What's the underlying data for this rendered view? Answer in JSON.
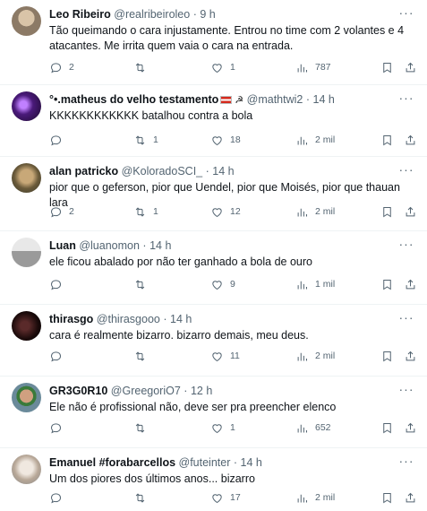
{
  "tweets": [
    {
      "name": "Leo Ribeiro",
      "handle": "@realribeiroleo",
      "time": "9 h",
      "text": "Tão queimando o cara injustamente. Entrou no time com 2 volantes e 4 atacantes. Me irrita quem vaia o cara na entrada.",
      "replies": "2",
      "retweets": "",
      "likes": "1",
      "views": "787",
      "avatar_color": "#b8a58c"
    },
    {
      "name": "°•.matheus do velho testamento",
      "handle": "@mathtwi2",
      "time": "14 h",
      "text": "KKKKKKKKKKKK batalhou contra a bola",
      "replies": "",
      "retweets": "1",
      "likes": "18",
      "views": "2 mil",
      "avatar_color": "#5a2a8a"
    },
    {
      "name": "alan patricko",
      "handle": "@KoloradoSCI_",
      "time": "14 h",
      "text": "pior que o geferson, pior que Uendel, pior que Moisés, pior que thauan lara",
      "replies": "2",
      "retweets": "1",
      "likes": "12",
      "views": "2 mil",
      "avatar_color": "#8a7a5a"
    },
    {
      "name": "Luan",
      "handle": "@luanomon",
      "time": "14 h",
      "text": "ele ficou abalado por não ter ganhado a bola de ouro",
      "replies": "",
      "retweets": "",
      "likes": "9",
      "views": "1 mil",
      "avatar_color": "#c9c9c9"
    },
    {
      "name": "thirasgo",
      "handle": "@thirasgooo",
      "time": "14 h",
      "text": "cara é realmente bizarro. bizarro demais, meu deus.",
      "replies": "",
      "retweets": "",
      "likes": "11",
      "views": "2 mil",
      "avatar_color": "#2a1a1a"
    },
    {
      "name": "GR3G0R10",
      "handle": "@GreegoriO7",
      "time": "12 h",
      "text": "Ele não é profissional não, deve ser pra preencher elenco",
      "replies": "",
      "retweets": "",
      "likes": "1",
      "views": "652",
      "avatar_color": "#a0785a"
    },
    {
      "name": "Emanuel #forabarcellos",
      "handle": "@futeinter",
      "time": "14 h",
      "text": "Um dos piores dos últimos anos... bizarro",
      "replies": "",
      "retweets": "",
      "likes": "17",
      "views": "2 mil",
      "avatar_color": "#d8d0c8"
    }
  ]
}
